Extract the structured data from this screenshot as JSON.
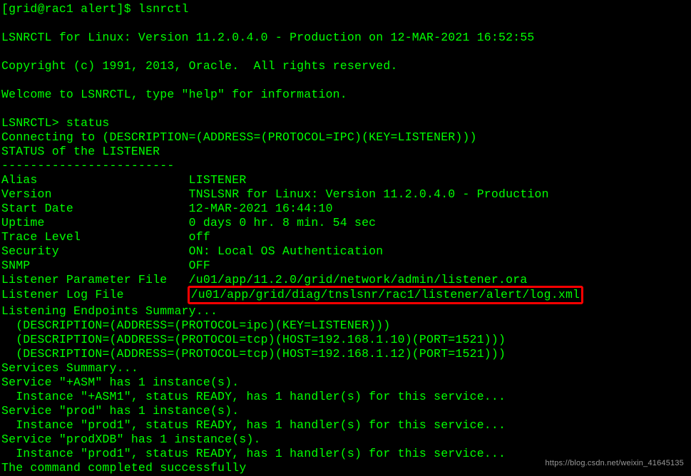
{
  "terminal": {
    "lines": [
      "[grid@rac1 alert]$ lsnrctl",
      "",
      "LSNRCTL for Linux: Version 11.2.0.4.0 - Production on 12-MAR-2021 16:52:55",
      "",
      "Copyright (c) 1991, 2013, Oracle.  All rights reserved.",
      "",
      "Welcome to LSNRCTL, type \"help\" for information.",
      "",
      "LSNRCTL> status",
      "Connecting to (DESCRIPTION=(ADDRESS=(PROTOCOL=IPC)(KEY=LISTENER)))",
      "STATUS of the LISTENER",
      "------------------------",
      "Alias                     LISTENER",
      "Version                   TNSLSNR for Linux: Version 11.2.0.4.0 - Production",
      "Start Date                12-MAR-2021 16:44:10",
      "Uptime                    0 days 0 hr. 8 min. 54 sec",
      "Trace Level               off",
      "Security                  ON: Local OS Authentication",
      "SNMP                      OFF",
      "Listener Parameter File   /u01/app/11.2.0/grid/network/admin/listener.ora"
    ],
    "logFileLine": {
      "label": "Listener Log File         ",
      "path": "/u01/app/grid/diag/tnslsnr/rac1/listener/alert/log.xml"
    },
    "restLines": [
      "Listening Endpoints Summary...",
      "  (DESCRIPTION=(ADDRESS=(PROTOCOL=ipc)(KEY=LISTENER)))",
      "  (DESCRIPTION=(ADDRESS=(PROTOCOL=tcp)(HOST=192.168.1.10)(PORT=1521)))",
      "  (DESCRIPTION=(ADDRESS=(PROTOCOL=tcp)(HOST=192.168.1.12)(PORT=1521)))",
      "Services Summary...",
      "Service \"+ASM\" has 1 instance(s).",
      "  Instance \"+ASM1\", status READY, has 1 handler(s) for this service...",
      "Service \"prod\" has 1 instance(s).",
      "  Instance \"prod1\", status READY, has 1 handler(s) for this service...",
      "Service \"prodXDB\" has 1 instance(s).",
      "  Instance \"prod1\", status READY, has 1 handler(s) for this service...",
      "The command completed successfully"
    ]
  },
  "watermark": "https://blog.csdn.net/weixin_41645135"
}
